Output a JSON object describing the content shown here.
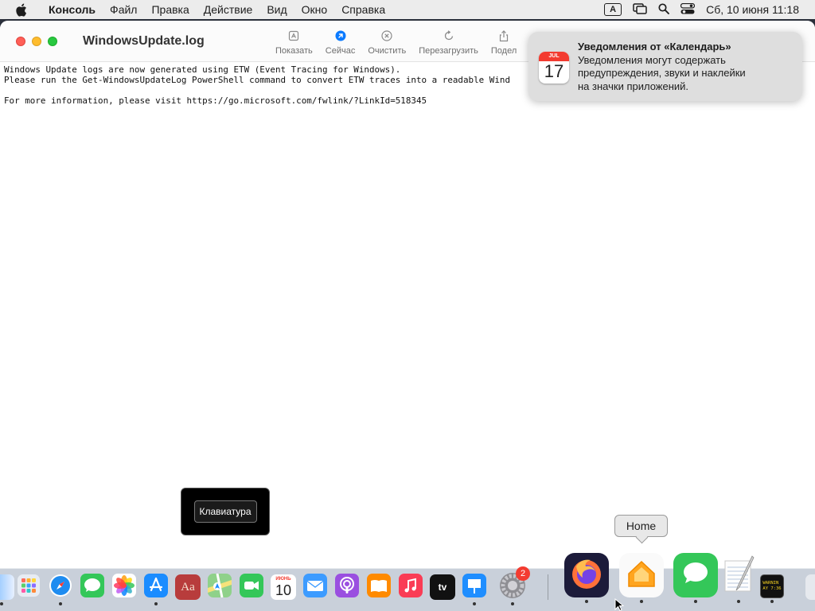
{
  "menubar": {
    "app_name": "Консоль",
    "items": [
      "Файл",
      "Правка",
      "Действие",
      "Вид",
      "Окно",
      "Справка"
    ],
    "input_indicator": "A",
    "datetime": "Сб, 10 июня  11:18"
  },
  "window": {
    "title": "WindowsUpdate.log",
    "tools": [
      {
        "label": "Показать",
        "icon": "show-icon"
      },
      {
        "label": "Сейчас",
        "icon": "now-icon"
      },
      {
        "label": "Очистить",
        "icon": "clear-icon"
      },
      {
        "label": "Перезагрузить",
        "icon": "reload-icon"
      },
      {
        "label": "Подел",
        "icon": "share-icon"
      }
    ],
    "log_lines": [
      "Windows Update logs are now generated using ETW (Event Tracing for Windows).",
      "Please run the Get-WindowsUpdateLog PowerShell command to convert ETW traces into a readable Wind",
      "",
      "For more information, please visit https://go.microsoft.com/fwlink/?LinkId=518345"
    ]
  },
  "notification": {
    "calendar_month": "JUL",
    "calendar_day": "17",
    "title": "Уведомления от «Календарь»",
    "line1": "Уведомления могут содержать",
    "line2": "предупреждения, звуки и наклейки",
    "line3": "на значки приложений."
  },
  "keyboard_hud": {
    "label": "Клавиатура"
  },
  "dock_tooltip": {
    "label": "Home"
  },
  "dock": {
    "calendar_month": "ИЮНЬ",
    "calendar_day": "10",
    "settings_badge": "2",
    "dictionary_label": "Aa",
    "tv_label": "tv",
    "console_label": "WARNIN\nAY 7:36",
    "items": [
      "finder",
      "launchpad",
      "safari",
      "messages",
      "photos",
      "app-store",
      "dictionary",
      "maps",
      "facetime",
      "calendar",
      "mail",
      "podcasts",
      "books",
      "music",
      "apple-tv",
      "keynote",
      "system-settings",
      "firefox",
      "home",
      "messages",
      "textedit",
      "console",
      "trash"
    ]
  },
  "colors": {
    "close": "#ff5f57",
    "minimize": "#febc2e",
    "zoom": "#28c840",
    "accent": "#0a7aff",
    "badge": "#f33b30"
  }
}
